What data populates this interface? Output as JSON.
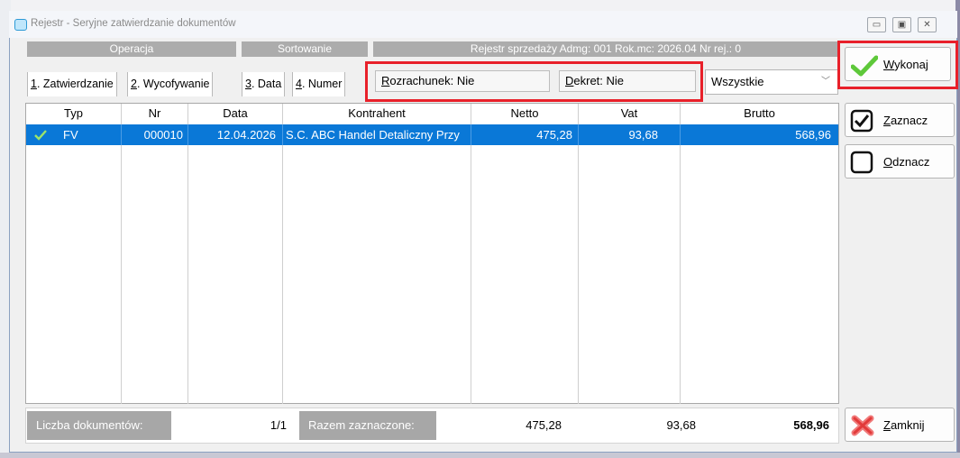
{
  "window": {
    "title": "Rejestr - Seryjne zatwierdzanie dokumentów",
    "controls": [
      "minimize-icon",
      "maximize-icon",
      "close-icon"
    ]
  },
  "header": {
    "operacja": "Operacja",
    "sortowanie": "Sortowanie",
    "info": "Rejestr sprzedaży   Admg: 001   Rok.mc: 2026.04   Nr rej.: 0"
  },
  "tabs": {
    "op1": {
      "key": "1",
      "rest": ". Zatwierdzanie"
    },
    "op2": {
      "key": "2",
      "rest": ". Wycofywanie"
    },
    "sort1": {
      "key": "3",
      "rest": ". Data"
    },
    "sort2": {
      "key": "4",
      "rest": ". Numer"
    }
  },
  "filters": {
    "rozrachunek": {
      "key": "R",
      "rest": "ozrachunek: Nie"
    },
    "dekret": {
      "key": "D",
      "rest": "ekret: Nie"
    },
    "status_select": "Wszystkie"
  },
  "table": {
    "columns": [
      "Typ",
      "Nr",
      "Data",
      "Kontrahent",
      "Netto",
      "Vat",
      "Brutto"
    ],
    "rows": [
      {
        "typ": "FV",
        "nr": "000010",
        "data": "12.04.2026",
        "kontrahent": "S.C. ABC Handel Detaliczny Przy",
        "netto": "475,28",
        "vat": "93,68",
        "brutto": "568,96",
        "checked": true
      }
    ]
  },
  "footer": {
    "liczba_label": "Liczba dokumentów:",
    "liczba_value": "1/1",
    "razem_label": "Razem zaznaczone:",
    "netto": "475,28",
    "vat": "93,68",
    "brutto": "568,96"
  },
  "buttons": {
    "wykonaj": {
      "key": "W",
      "rest": "ykonaj"
    },
    "zaznacz": {
      "key": "Z",
      "rest": "aznacz"
    },
    "odznacz": {
      "key": "O",
      "rest": "dznacz"
    },
    "zamknij": {
      "key": "Z",
      "rest": "amknij"
    }
  },
  "colors": {
    "selection": "#0a78d7",
    "highlight_box": "#e8202a",
    "header_bar": "#acacac"
  }
}
